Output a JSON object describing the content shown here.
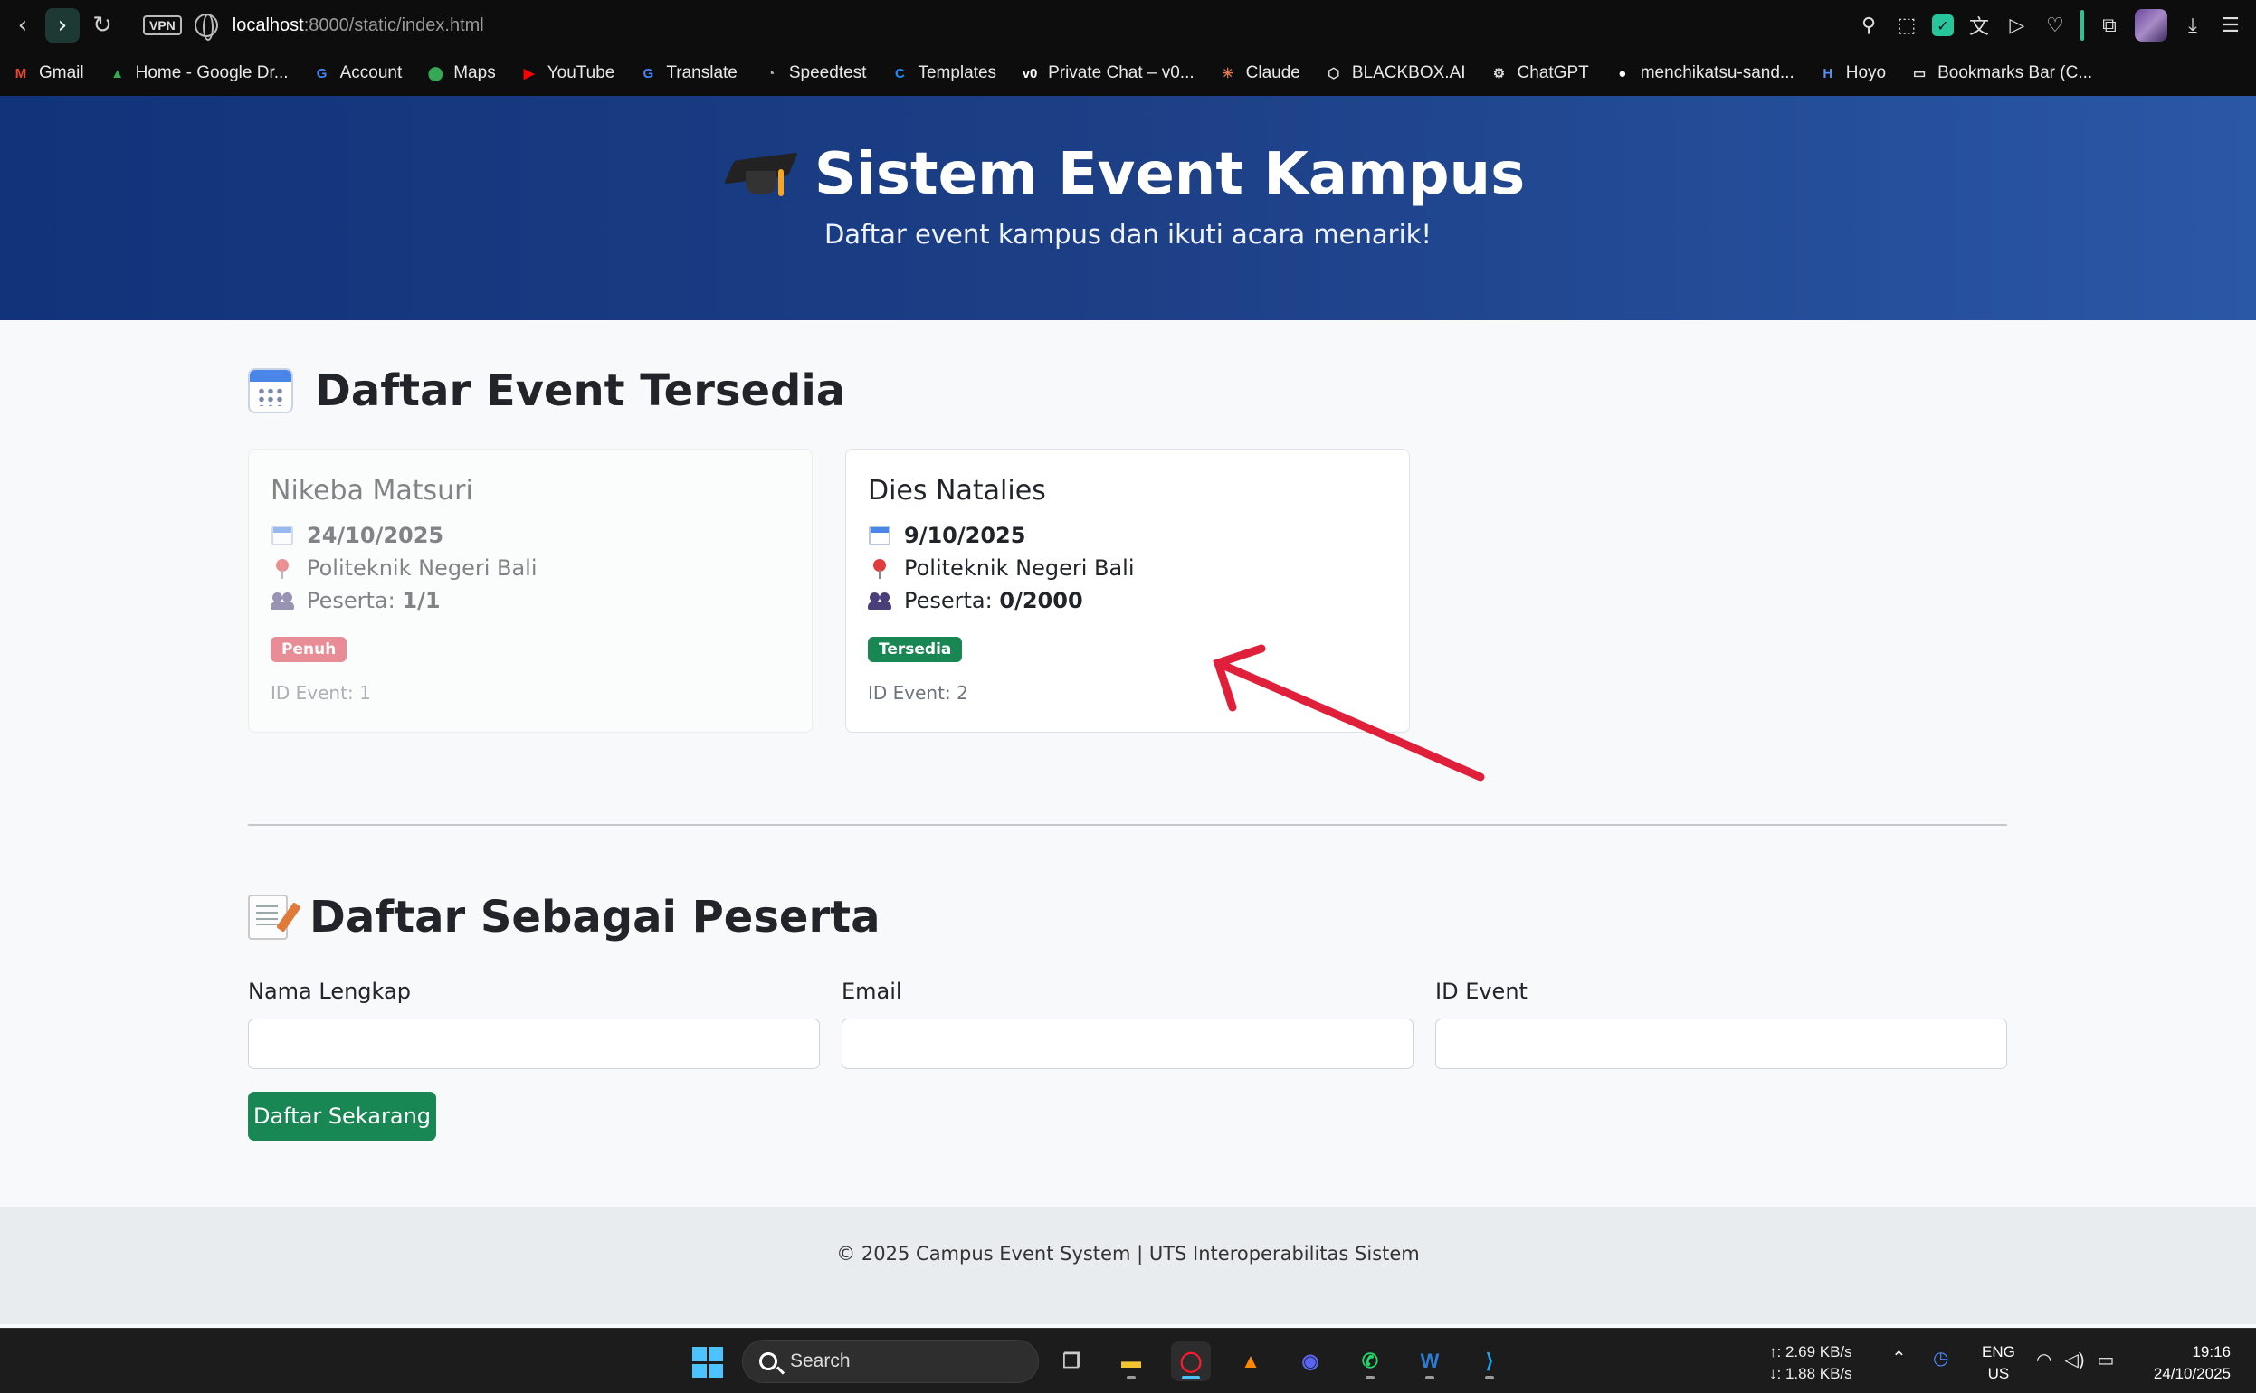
{
  "browser": {
    "url_host": "localhost",
    "url_rest": ":8000/static/index.html",
    "vpn_label": "VPN"
  },
  "bookmarks": [
    {
      "label": "Gmail",
      "icon": "gmail-icon",
      "color": "#ea4335",
      "glyph": "M"
    },
    {
      "label": "Home - Google Dr...",
      "icon": "google-drive-icon",
      "color": "#34a853",
      "glyph": "▲"
    },
    {
      "label": "Account",
      "icon": "google-icon",
      "color": "#4285f4",
      "glyph": "G"
    },
    {
      "label": "Maps",
      "icon": "maps-icon",
      "color": "#34a853",
      "glyph": "⬤"
    },
    {
      "label": "YouTube",
      "icon": "youtube-icon",
      "color": "#ff0000",
      "glyph": "▶"
    },
    {
      "label": "Translate",
      "icon": "translate-icon",
      "color": "#4285f4",
      "glyph": "G"
    },
    {
      "label": "Speedtest",
      "icon": "speedtest-icon",
      "color": "#bbbbbb",
      "glyph": "◔"
    },
    {
      "label": "Templates",
      "icon": "canva-icon",
      "color": "#1a8cff",
      "glyph": "C"
    },
    {
      "label": "Private Chat – v0...",
      "icon": "v0-icon",
      "color": "#ffffff",
      "glyph": "v0"
    },
    {
      "label": "Claude",
      "icon": "claude-icon",
      "color": "#d97757",
      "glyph": "✳"
    },
    {
      "label": "BLACKBOX.AI",
      "icon": "blackbox-icon",
      "color": "#dddddd",
      "glyph": "⬡"
    },
    {
      "label": "ChatGPT",
      "icon": "chatgpt-icon",
      "color": "#dddddd",
      "glyph": "⚙"
    },
    {
      "label": "menchikatsu-sand...",
      "icon": "github-icon",
      "color": "#ffffff",
      "glyph": "●"
    },
    {
      "label": "Hoyo",
      "icon": "hoyo-icon",
      "color": "#5b8def",
      "glyph": "H"
    },
    {
      "label": "Bookmarks Bar (C...",
      "icon": "folder-icon",
      "color": "#dddddd",
      "glyph": "▭"
    }
  ],
  "header": {
    "title": "Sistem Event Kampus",
    "subtitle": "Daftar event kampus dan ikuti acara menarik!"
  },
  "events_section": {
    "title": "Daftar Event Tersedia",
    "participants_label": "Peserta:",
    "id_label": "ID Event:",
    "events": [
      {
        "name": "Nikeba Matsuri",
        "date": "24/10/2025",
        "location": "Politeknik Negeri Bali",
        "participants": "1/1",
        "status": "Penuh",
        "status_color": "#dc3545",
        "id": "1"
      },
      {
        "name": "Dies Natalies",
        "date": "9/10/2025",
        "location": "Politeknik Negeri Bali",
        "participants": "0/2000",
        "status": "Tersedia",
        "status_color": "#198754",
        "id": "2"
      }
    ]
  },
  "register_section": {
    "title": "Daftar Sebagai Peserta",
    "fields": [
      {
        "label": "Nama Lengkap",
        "value": ""
      },
      {
        "label": "Email",
        "value": ""
      },
      {
        "label": "ID Event",
        "value": ""
      }
    ],
    "submit_label": "Daftar Sekarang"
  },
  "footer": {
    "text": "© 2025 Campus Event System | UTS Interoperabilitas Sistem"
  },
  "taskbar": {
    "search_label": "Search",
    "upload_speed": "↑: 2.69 KB/s",
    "download_speed": "↓: 1.88 KB/s",
    "lang_top": "ENG",
    "lang_bottom": "US",
    "time": "19:16",
    "date": "24/10/2025"
  },
  "colors": {
    "header_gradient_start": "#10337a",
    "header_gradient_end": "#2a57a6",
    "primary_button": "#198754",
    "annotation_arrow": "#e0203a"
  }
}
